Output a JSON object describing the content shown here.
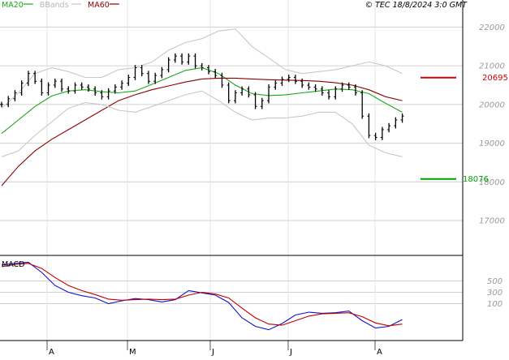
{
  "chart_data": [
    {
      "type": "line",
      "panel": "price",
      "title": "© TEC 18/8/2024 3:0 GMT",
      "y_ticks": [
        17000,
        18000,
        19000,
        20000,
        21000,
        22000
      ],
      "y_tick_labels": [
        "17000",
        "18000",
        "19000",
        "20000",
        "21000",
        "22000"
      ],
      "ylim": [
        16100,
        22700
      ],
      "x_months": [
        "A",
        "M",
        "J",
        "J",
        "A"
      ],
      "grid": true,
      "legend": [
        {
          "label": "MA20",
          "color": "#1aa81a"
        },
        {
          "label": "BBands",
          "color": "#c8c8c8"
        },
        {
          "label": "MA60",
          "color": "#8b0000"
        }
      ],
      "levels": [
        {
          "label": "20695",
          "value": 20695,
          "color": "#d40000"
        },
        {
          "label": "18076",
          "value": 18076,
          "color": "#00a000"
        }
      ],
      "series": [
        {
          "name": "MA20",
          "color": "#1aa81a",
          "x": [
            0,
            5,
            10,
            15,
            20,
            25,
            30,
            35,
            40,
            45,
            50,
            55,
            60,
            65,
            70,
            75,
            80,
            85,
            90,
            95,
            100,
            105,
            110,
            115,
            120
          ],
          "values": [
            19250,
            19600,
            19950,
            20220,
            20350,
            20380,
            20330,
            20300,
            20350,
            20520,
            20700,
            20880,
            20950,
            20800,
            20500,
            20280,
            20230,
            20250,
            20300,
            20350,
            20400,
            20380,
            20280,
            20030,
            19800
          ]
        },
        {
          "name": "MA60",
          "color": "#8b0000",
          "x": [
            0,
            5,
            10,
            15,
            20,
            25,
            30,
            35,
            40,
            45,
            50,
            55,
            60,
            65,
            70,
            75,
            80,
            85,
            90,
            95,
            100,
            105,
            110,
            115,
            120
          ],
          "values": [
            17900,
            18400,
            18800,
            19100,
            19350,
            19600,
            19850,
            20100,
            20250,
            20380,
            20480,
            20580,
            20660,
            20680,
            20680,
            20660,
            20640,
            20630,
            20620,
            20600,
            20560,
            20500,
            20380,
            20200,
            20100
          ]
        },
        {
          "name": "BBands upper",
          "color": "#c8c8c8",
          "x": [
            0,
            5,
            10,
            15,
            20,
            25,
            30,
            35,
            40,
            45,
            50,
            55,
            60,
            65,
            70,
            75,
            80,
            85,
            90,
            95,
            100,
            105,
            110,
            115,
            120
          ],
          "values": [
            19900,
            20300,
            20800,
            20950,
            20850,
            20700,
            20700,
            20900,
            20950,
            21100,
            21400,
            21600,
            21700,
            21900,
            21950,
            21500,
            21200,
            20900,
            20800,
            20850,
            20900,
            21000,
            21100,
            21000,
            20800
          ]
        },
        {
          "name": "BBands lower",
          "color": "#c8c8c8",
          "x": [
            0,
            5,
            10,
            15,
            20,
            25,
            30,
            35,
            40,
            45,
            50,
            55,
            60,
            65,
            70,
            75,
            80,
            85,
            90,
            95,
            100,
            105,
            110,
            115,
            120
          ],
          "values": [
            18650,
            18800,
            19200,
            19550,
            19900,
            20050,
            20000,
            19850,
            19800,
            19950,
            20100,
            20250,
            20350,
            20100,
            19800,
            19600,
            19650,
            19650,
            19700,
            19800,
            19800,
            19500,
            18950,
            18750,
            18650
          ]
        },
        {
          "name": "Price",
          "color": "#000000",
          "type": "ohlc",
          "x": [
            0,
            2,
            4,
            6,
            8,
            10,
            12,
            14,
            16,
            18,
            20,
            22,
            24,
            26,
            28,
            30,
            32,
            34,
            36,
            38,
            40,
            42,
            44,
            46,
            48,
            50,
            52,
            54,
            56,
            58,
            60,
            62,
            64,
            66,
            68,
            70,
            72,
            74,
            76,
            78,
            80,
            82,
            84,
            86,
            88,
            90,
            92,
            94,
            96,
            98,
            100,
            102,
            104,
            106,
            108,
            110,
            112,
            114,
            116,
            118,
            120
          ],
          "values": [
            20000,
            20150,
            20300,
            20550,
            20800,
            20600,
            20300,
            20500,
            20600,
            20400,
            20350,
            20500,
            20450,
            20400,
            20300,
            20200,
            20350,
            20450,
            20550,
            20700,
            20950,
            20800,
            20600,
            20750,
            20900,
            21150,
            21250,
            21100,
            21250,
            21000,
            20950,
            20850,
            20750,
            20500,
            20100,
            20300,
            20400,
            20250,
            19950,
            20100,
            20450,
            20550,
            20650,
            20700,
            20600,
            20500,
            20450,
            20400,
            20300,
            20200,
            20400,
            20500,
            20450,
            20300,
            19700,
            19200,
            19150,
            19350,
            19450,
            19600,
            19700
          ]
        }
      ]
    },
    {
      "type": "line",
      "panel": "macd",
      "title": "MACD",
      "y_ticks": [
        100,
        300,
        500
      ],
      "y_tick_labels": [
        "100",
        "300",
        "500"
      ],
      "ylim": [
        -550,
        950
      ],
      "grid": true,
      "series": [
        {
          "name": "MACD",
          "color": "#1010d0",
          "x": [
            0,
            4,
            8,
            12,
            16,
            20,
            24,
            28,
            32,
            36,
            40,
            44,
            48,
            52,
            56,
            60,
            64,
            68,
            72,
            76,
            80,
            84,
            88,
            92,
            96,
            100,
            104,
            108,
            112,
            116,
            120
          ],
          "values": [
            780,
            810,
            830,
            650,
            420,
            300,
            240,
            200,
            100,
            150,
            190,
            170,
            130,
            170,
            330,
            290,
            250,
            120,
            -150,
            -300,
            -360,
            -250,
            -100,
            -50,
            -70,
            -60,
            -30,
            -200,
            -330,
            -300,
            -180
          ]
        },
        {
          "name": "Signal",
          "color": "#c00000",
          "x": [
            0,
            4,
            8,
            12,
            16,
            20,
            24,
            28,
            32,
            36,
            40,
            44,
            48,
            52,
            56,
            60,
            64,
            68,
            72,
            76,
            80,
            84,
            88,
            92,
            96,
            100,
            104,
            108,
            112,
            116,
            120
          ],
          "values": [
            750,
            790,
            810,
            720,
            560,
            420,
            330,
            260,
            180,
            160,
            170,
            180,
            170,
            180,
            250,
            300,
            270,
            200,
            20,
            -150,
            -260,
            -280,
            -200,
            -120,
            -80,
            -70,
            -60,
            -130,
            -240,
            -290,
            -260
          ]
        }
      ]
    }
  ]
}
